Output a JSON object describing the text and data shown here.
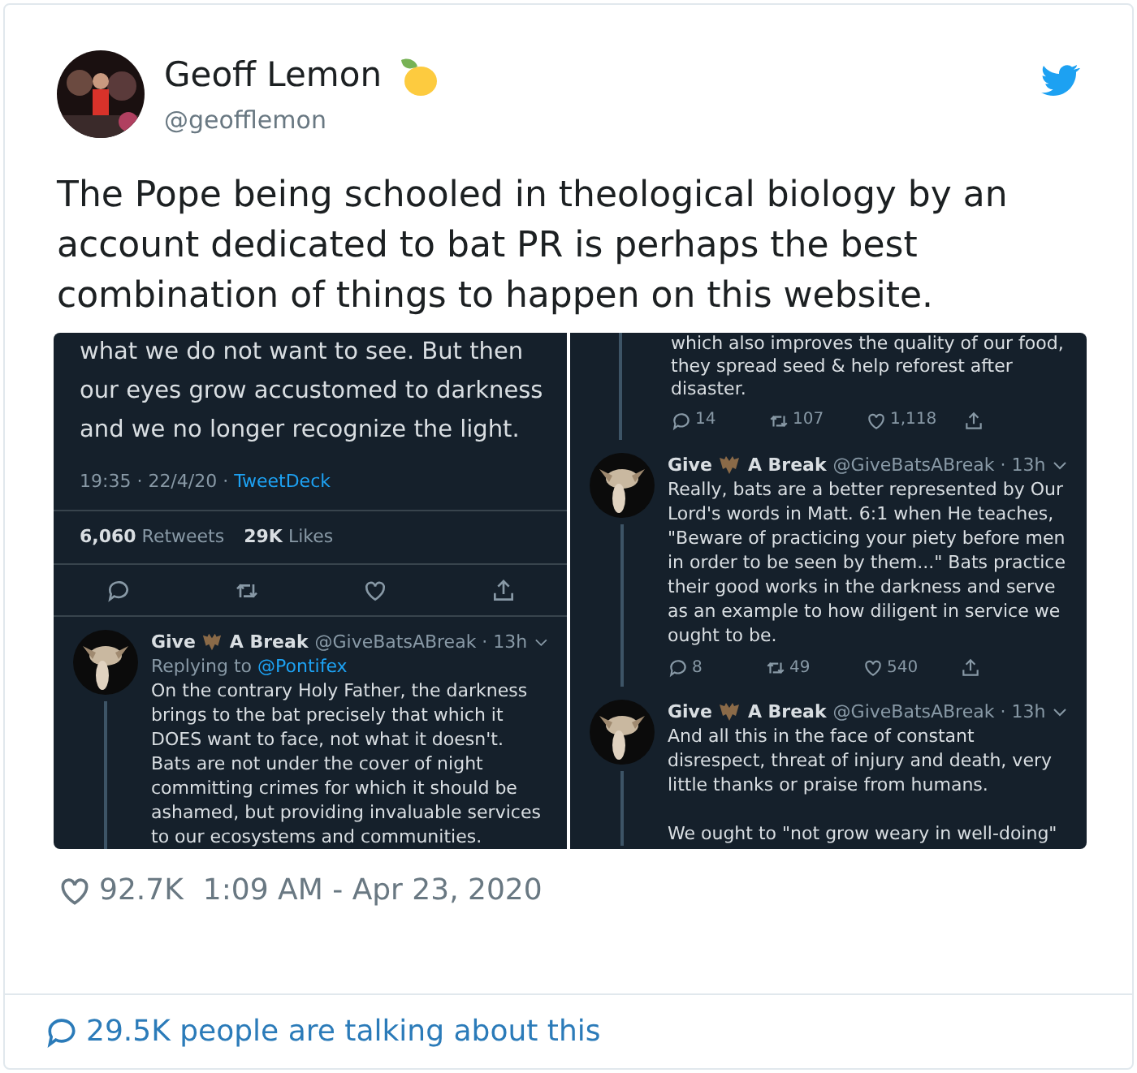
{
  "author": {
    "name": "Geoff Lemon",
    "handle": "@geofflemon"
  },
  "text": "The Pope being schooled in theological biology by an account dedicated to bat PR is perhaps the best combination of things to happen on this website.",
  "media": {
    "left": {
      "tail": [
        "what we do not want to see. But then",
        "our eyes grow accustomed to darkness",
        "and we no longer recognize the light."
      ],
      "meta": "19:35 · 22/4/20 ·",
      "source": "TweetDeck",
      "stats": [
        {
          "count": "6,060",
          "label": "Retweets"
        },
        {
          "count": "29K",
          "label": "Likes"
        }
      ],
      "replies": [
        {
          "name_start": "Give",
          "name_end": "A Break",
          "handle": "@GiveBatsABreak · 13h",
          "replying_label": "Replying to",
          "replying_handle": "@Pontifex",
          "paragraphs": [
            "On the contrary Holy Father, the darkness brings to the bat precisely that which it DOES want to face, not what it doesn't. Bats are not under the cover of night committing crimes for which it should be ashamed, but providing invaluable services to our ecosystems and communities."
          ]
        }
      ]
    },
    "right": {
      "tail": [
        "which also improves the quality of our food,",
        "they spread seed & help reforest after",
        "disaster."
      ],
      "counts": [
        "14",
        "107",
        "1,118"
      ],
      "replies": [
        {
          "name_start": "Give",
          "name_end": "A Break",
          "handle": "@GiveBatsABreak · 13h",
          "paragraphs": [
            "Really, bats are a better represented by Our Lord's words in Matt. 6:1 when He teaches, \"Beware of practicing your piety before men in order to be seen by them...\" Bats practice their good works in the darkness and serve as an example to how diligent in service we ought to be."
          ],
          "counts": [
            "8",
            "49",
            "540"
          ]
        },
        {
          "name_start": "Give",
          "name_end": "A Break",
          "handle": "@GiveBatsABreak · 13h",
          "paragraphs": [
            "And all this in the face of constant disrespect, threat of injury and death, very little thanks or praise from humans.",
            "We ought to \"not grow weary in well-doing\""
          ]
        }
      ]
    }
  },
  "likes": "92.7K",
  "timestamp": "1:09 AM - Apr 23, 2020",
  "talking": "29.5K people are talking about this"
}
